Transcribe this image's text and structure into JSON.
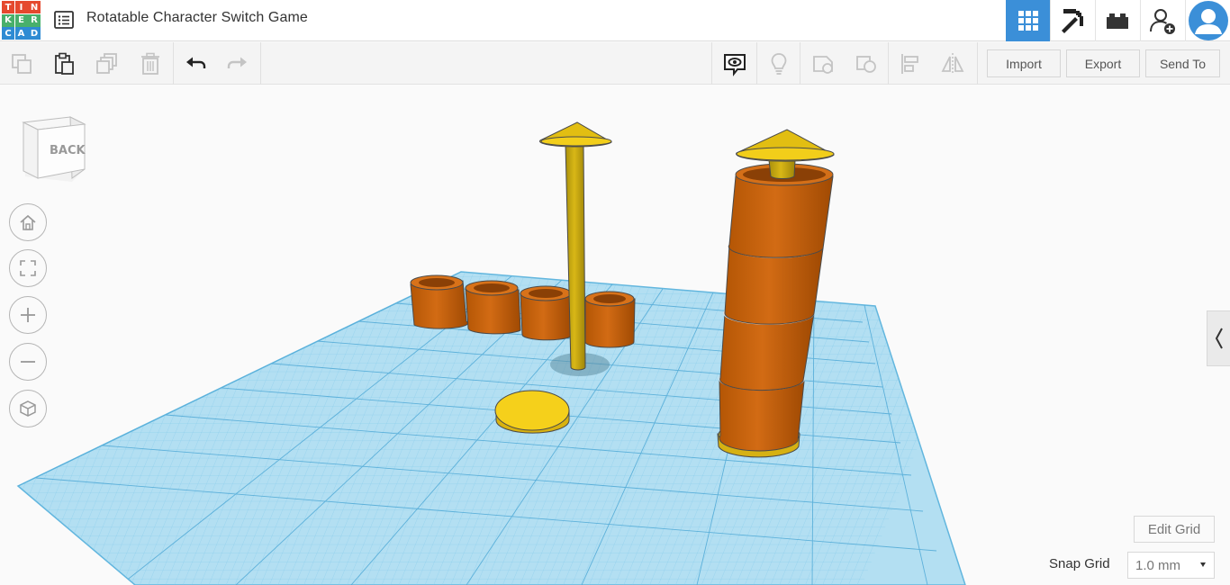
{
  "app": {
    "logo_letters": [
      "T",
      "I",
      "N",
      "K",
      "E",
      "R",
      "C",
      "A",
      "D"
    ],
    "logo_colors": [
      "#e5492e",
      "#e5492e",
      "#e5492e",
      "#48b06b",
      "#48b06b",
      "#48b06b",
      "#2e8bd3",
      "#2e8bd3",
      "#2e8bd3"
    ],
    "title": "Rotatable Character Switch Game"
  },
  "topbar": {
    "buttons": [
      {
        "icon": "3d-design-grid-icon",
        "active": true
      },
      {
        "icon": "pickaxe-icon",
        "active": false
      },
      {
        "icon": "brick-icon",
        "active": false
      },
      {
        "icon": "add-user-icon",
        "active": false
      },
      {
        "icon": "avatar-icon",
        "active": false
      }
    ],
    "accent": "#3b8fd8"
  },
  "toolbar": {
    "left_tools": [
      "copy-icon",
      "paste-icon",
      "duplicate-icon",
      "delete-icon",
      "undo-icon",
      "redo-icon"
    ],
    "right_tools": [
      "notes-icon",
      "light-icon",
      "group-icon",
      "ungroup-icon",
      "align-icon",
      "mirror-icon"
    ],
    "import_label": "Import",
    "export_label": "Export",
    "send_to_label": "Send To"
  },
  "viewcube": {
    "face_label": "BACK"
  },
  "nav": [
    "home-icon",
    "fit-view-icon",
    "zoom-in-icon",
    "zoom-out-icon",
    "perspective-icon"
  ],
  "bottom": {
    "edit_grid_label": "Edit Grid",
    "snap_grid_label": "Snap Grid",
    "snap_grid_value": "1.0 mm"
  },
  "colors": {
    "workplane": "#a9d9ef",
    "grid_line": "#6bbfe5",
    "orange": "#c9610e",
    "yellow": "#f0cc14"
  }
}
